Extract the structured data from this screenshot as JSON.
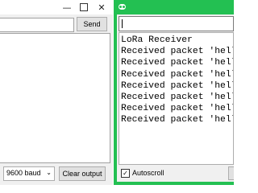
{
  "left_window": {
    "title_buttons": {
      "minimize": "—",
      "close": "✕"
    },
    "send_label": "Send",
    "baud": "9600 baud",
    "clear_label": "Clear output"
  },
  "right_window": {
    "icon": "arduino-icon",
    "input_value": "",
    "output_lines": [
      "LoRa Receiver",
      "Received packet 'hello",
      "Received packet 'hello",
      "Received packet 'hello",
      "Received packet 'hello",
      "Received packet 'hello",
      "Received packet 'hello",
      "Received packet 'hello"
    ],
    "autoscroll_label": "Autoscroll",
    "autoscroll_checked": "✓"
  },
  "colors": {
    "active_border": "#23c052",
    "window_bg": "#f0f0f0"
  }
}
